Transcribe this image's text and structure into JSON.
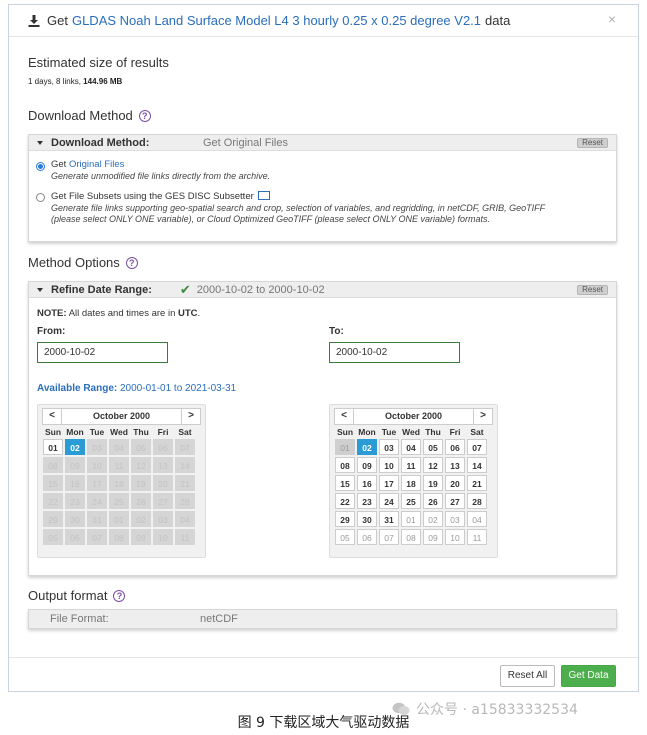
{
  "header": {
    "prefix": "Get",
    "dataset_link": "GLDAS Noah Land Surface Model L4 3 hourly 0.25 x 0.25 degree V2.1",
    "suffix": "data",
    "close_glyph": "×"
  },
  "estimate": {
    "title": "Estimated size of results",
    "days": "1 days,",
    "links": "8 links,",
    "size": "144.96 MB"
  },
  "download_method": {
    "section_title": "Download Method",
    "panel_label": "Download Method:",
    "panel_value": "Get Original Files",
    "reset_label": "Reset",
    "options": [
      {
        "prefix": "Get",
        "link": "Original Files",
        "description": "Generate unmodified file links directly from the archive.",
        "selected": true
      },
      {
        "prefix": "Get File Subsets using the GES DISC Subsetter",
        "link": "",
        "description": "Generate file links supporting geo-spatial search and crop, selection of variables, and regridding, in netCDF, GRIB, GeoTIFF",
        "description2": "(please select ONLY ONE variable), or Cloud Optimized GeoTIFF (please select ONLY ONE variable) formats.",
        "selected": false
      }
    ]
  },
  "method_options": {
    "section_title": "Method Options",
    "panel_label": "Refine Date Range:",
    "panel_value": "2000-10-02 to 2000-10-02",
    "reset_label": "Reset",
    "note_bold": "NOTE:",
    "note_text": "All dates and times are in",
    "note_tz": "UTC",
    "from_label": "From:",
    "to_label": "To:",
    "from_value": "2000-10-02",
    "to_value": "2000-10-02",
    "available_label": "Available Range:",
    "available_value": "2000-01-01 to 2021-03-31"
  },
  "calendar": {
    "month": "October 2000",
    "prev": "<",
    "next": ">",
    "dow": [
      "Sun",
      "Mon",
      "Tue",
      "Wed",
      "Thu",
      "Fri",
      "Sat"
    ],
    "days": [
      "01",
      "02",
      "03",
      "04",
      "05",
      "06",
      "07",
      "08",
      "09",
      "10",
      "11",
      "12",
      "13",
      "14",
      "15",
      "16",
      "17",
      "18",
      "19",
      "20",
      "21",
      "22",
      "23",
      "24",
      "25",
      "26",
      "27",
      "28",
      "29",
      "30",
      "31",
      "01",
      "02",
      "03",
      "04",
      "05",
      "06",
      "07",
      "08",
      "09",
      "10",
      "11"
    ]
  },
  "output_format": {
    "section_title": "Output format",
    "key": "File Format:",
    "value": "netCDF"
  },
  "buttons": {
    "reset_all": "Reset All",
    "get_data": "Get Data"
  },
  "caption": "图  9  下载区域大气驱动数据",
  "watermark": "公众号 · a15833332534",
  "colors": {
    "link": "#2a6ebb",
    "selected_day": "#2a9bd4",
    "get_data": "#4cae4c",
    "input_border": "#3a7a3a"
  }
}
